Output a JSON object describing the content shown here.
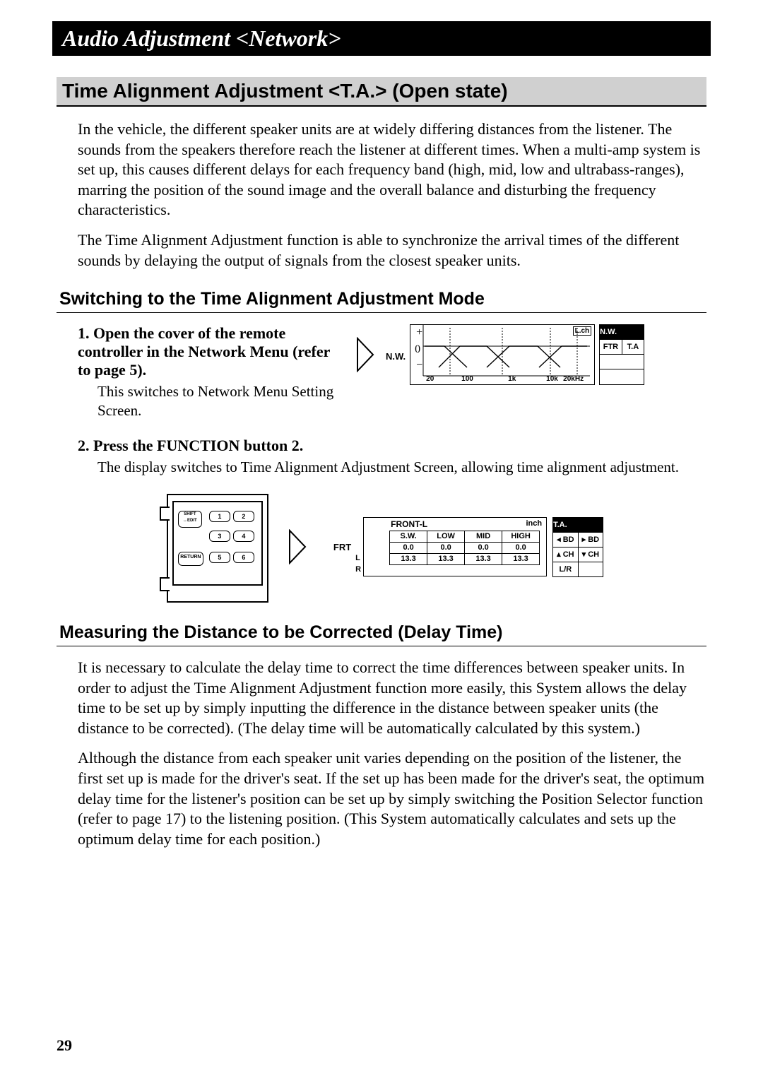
{
  "page_number": "29",
  "banner": "Audio Adjustment <Network>",
  "section_title": "Time Alignment Adjustment <T.A.> (Open state)",
  "intro_para_1": "In the vehicle, the different speaker units are at widely differing distances from the listener. The sounds from the speakers therefore reach the listener at different times. When a multi-amp system is set up, this causes different delays for each frequency band (high, mid, low and ultrabass-ranges), marring the position of the sound image and the overall balance and disturbing the frequency characteristics.",
  "intro_para_2": "The Time Alignment Adjustment function is able to synchronize the arrival times of the different sounds by delaying the output of signals from the closest speaker units.",
  "sub1": "Switching to the Time Alignment Adjustment Mode",
  "step1_num": "1.",
  "step1_bold": "Open the cover of the remote controller in the Network Menu (refer to page 5).",
  "step1_text": "This switches to Network Menu Setting Screen.",
  "step2_num": "2.",
  "step2_bold": "Press the FUNCTION button 2.",
  "step2_text": "The display switches to Time Alignment Adjustment Screen, allowing time alignment adjustment.",
  "sub2": "Measuring the Distance to be Corrected (Delay Time)",
  "meas_para_1": "It is necessary to calculate the delay time to correct the time differences between speaker units. In order to adjust the Time Alignment Adjustment function more easily, this System allows the delay time to be set up by simply inputting the difference in the distance between speaker units (the distance to be corrected). (The delay time will be automatically calculated by this system.)",
  "meas_para_2": "Although the distance from each speaker unit varies depending on the position of the listener, the first set up is made for the driver's seat. If the set up has been made for the driver's seat, the optimum delay time for the listener's position can be set up by simply switching the Position Selector function (refer to page 17) to the listening position. (This System automatically calculates and sets up the optimum delay time for each position.)",
  "diagram1": {
    "nw_label": "N.W.",
    "y_plus": "+",
    "y_zero": "0",
    "y_minus": "−",
    "lch": "L.ch",
    "x_ticks": [
      "20",
      "100",
      "1k",
      "10k",
      "20kHz"
    ],
    "side_top": "N.W.",
    "side_ftr": "FTR",
    "side_ta": "T.A"
  },
  "remote": {
    "shift": "SHIFT\n↔EDIT",
    "return": "RETURN",
    "btns": [
      "1",
      "2",
      "3",
      "4",
      "5",
      "6"
    ]
  },
  "diagram2": {
    "frt": "FRT",
    "L": "L",
    "R": "R",
    "title": "FRONT-L",
    "unit": "inch",
    "headers": [
      "S.W.",
      "LOW",
      "MID",
      "HIGH"
    ],
    "row_l": [
      "0.0",
      "0.0",
      "0.0",
      "0.0"
    ],
    "row_r": [
      "13.3",
      "13.3",
      "13.3",
      "13.3"
    ],
    "side_top": "T.A.",
    "side_bd_l": "◂ BD",
    "side_bd_r": "▸ BD",
    "side_ch_u": "▴ CH",
    "side_ch_d": "▾ CH",
    "side_lr": "L/R"
  }
}
